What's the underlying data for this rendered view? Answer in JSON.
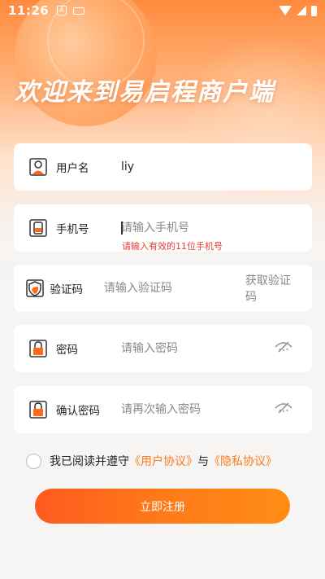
{
  "status_bar": {
    "time": "11:26",
    "notif_icon": "A"
  },
  "header": {
    "title": "欢迎来到易启程商户端"
  },
  "form": {
    "username": {
      "label": "用户名",
      "value": "liy"
    },
    "phone": {
      "label": "手机号",
      "placeholder": "请输入手机号",
      "error": "请输入有效的11位手机号"
    },
    "code": {
      "label": "验证码",
      "placeholder": "请输入验证码",
      "action": "获取验证码"
    },
    "password": {
      "label": "密码",
      "placeholder": "请输入密码"
    },
    "confirm": {
      "label": "确认密码",
      "placeholder": "请再次输入密码"
    }
  },
  "agreement": {
    "prefix": "我已阅读并遵守",
    "user_agreement": "《用户协议》",
    "and": "与",
    "privacy_agreement": "《隐私协议》"
  },
  "submit_label": "立即注册",
  "colors": {
    "accent": "#ff7a1a",
    "error": "#e53935"
  }
}
